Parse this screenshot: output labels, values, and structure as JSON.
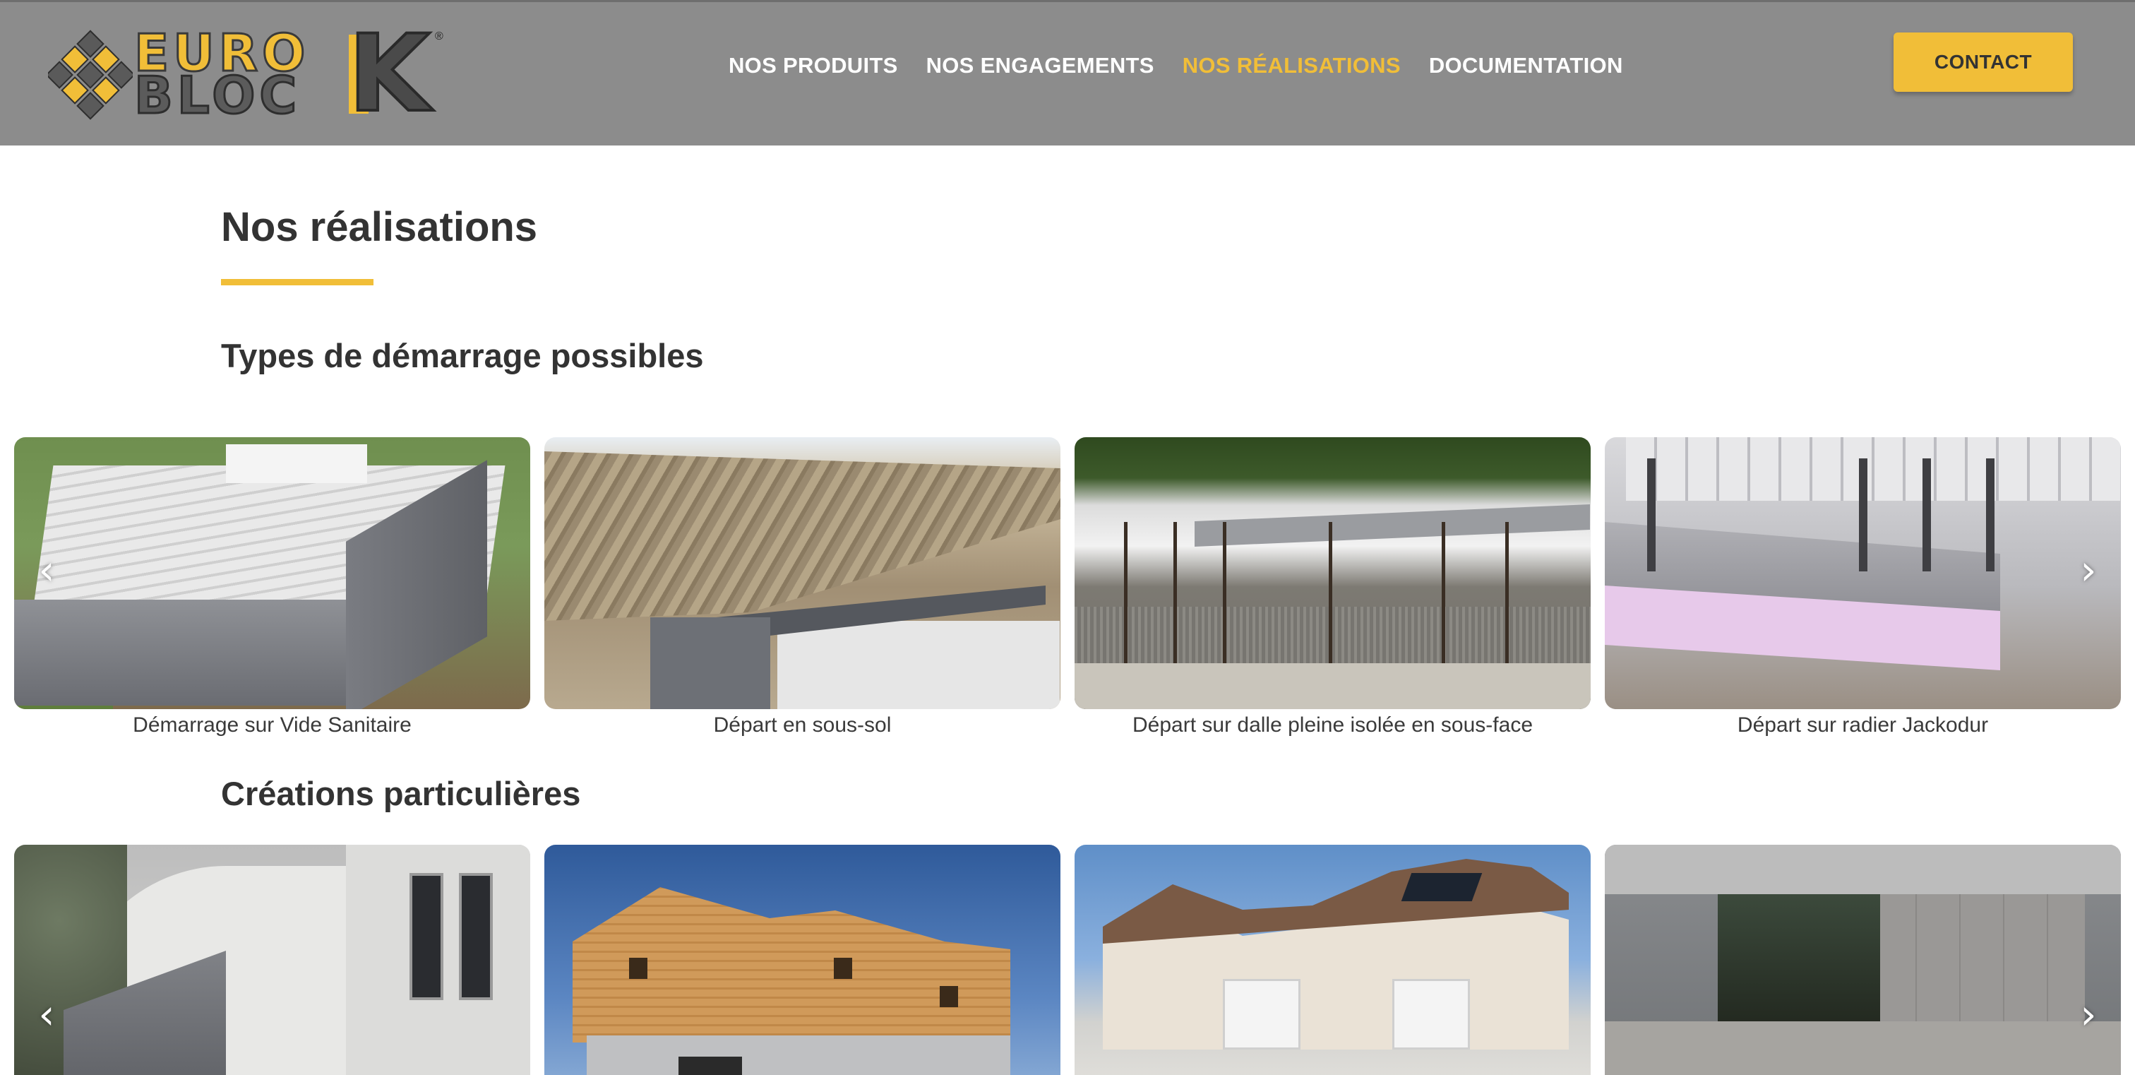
{
  "brand": {
    "name": "EUROBLOCK",
    "line1": "EURO",
    "line2": "BLOC",
    "letter": "K",
    "registered": "®",
    "colors": {
      "accent": "#f1be38",
      "header_bg": "#8c8c8c",
      "text": "#333333"
    }
  },
  "nav": {
    "items": [
      {
        "label": "NOS PRODUITS",
        "active": false
      },
      {
        "label": "NOS ENGAGEMENTS",
        "active": false
      },
      {
        "label": "NOS RÉALISATIONS",
        "active": true
      },
      {
        "label": "DOCUMENTATION",
        "active": false
      }
    ],
    "contact_label": "CONTACT"
  },
  "page": {
    "title": "Nos réalisations"
  },
  "sections": [
    {
      "title": "Types de démarrage possibles",
      "slides": [
        {
          "caption": "Démarrage sur Vide Sanitaire",
          "image": "vide-sanitaire-photo"
        },
        {
          "caption": "Départ en sous-sol",
          "image": "sous-sol-photo"
        },
        {
          "caption": "Départ sur dalle pleine isolée en sous-face",
          "image": "dalle-pleine-photo"
        },
        {
          "caption": "Départ sur radier Jackodur",
          "image": "radier-jackodur-photo"
        }
      ],
      "prev_icon": "chevron-left-icon",
      "next_icon": "chevron-right-icon"
    },
    {
      "title": "Créations particulières",
      "slides": [
        {
          "caption": "",
          "image": "modern-house-photo"
        },
        {
          "caption": "",
          "image": "wood-frame-house-photo"
        },
        {
          "caption": "",
          "image": "twin-houses-photo"
        },
        {
          "caption": "",
          "image": "concrete-terrace-photo"
        }
      ],
      "prev_icon": "chevron-left-icon",
      "next_icon": "chevron-right-icon"
    }
  ],
  "icons": {
    "prev": "‹",
    "next": "›"
  }
}
